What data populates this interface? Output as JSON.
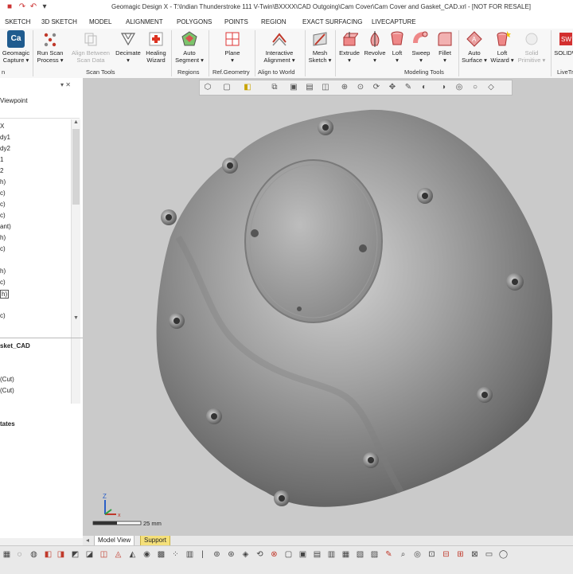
{
  "window": {
    "title": "Geomagic Design X - T:\\Indian Thunderstroke 111 V-Twin\\BXXXX\\CAD Outgoing\\Cam Cover\\Cam Cover and Gasket_CAD.xrl - [NOT FOR RESALE]"
  },
  "menu": [
    "SKETCH",
    "3D SKETCH",
    "MODEL",
    "ALIGNMENT",
    "POLYGONS",
    "POINTS",
    "REGION",
    "EXACT SURFACING",
    "LIVECAPTURE"
  ],
  "ribbon": {
    "buttons": [
      {
        "label1": "Geomagic",
        "label2": "Capture ▾",
        "icon": "capture-icon"
      },
      {
        "label1": "Run Scan",
        "label2": "Process ▾",
        "icon": "scan-process-icon"
      },
      {
        "label1": "Align Between",
        "label2": "Scan Data",
        "icon": "align-scan-icon",
        "disabled": true
      },
      {
        "label1": "Decimate",
        "label2": "▾",
        "icon": "decimate-icon"
      },
      {
        "label1": "Healing",
        "label2": "Wizard",
        "icon": "healing-icon"
      },
      {
        "label1": "Auto",
        "label2": "Segment ▾",
        "icon": "segment-icon"
      },
      {
        "label1": "Plane",
        "label2": "▾",
        "icon": "plane-icon"
      },
      {
        "label1": "Interactive",
        "label2": "Alignment ▾",
        "icon": "alignment-icon"
      },
      {
        "label1": "Mesh",
        "label2": "Sketch ▾",
        "icon": "mesh-sketch-icon"
      },
      {
        "label1": "Extrude",
        "label2": "▾",
        "icon": "extrude-icon"
      },
      {
        "label1": "Revolve",
        "label2": "▾",
        "icon": "revolve-icon"
      },
      {
        "label1": "Loft",
        "label2": "▾",
        "icon": "loft-icon"
      },
      {
        "label1": "Sweep",
        "label2": "▾",
        "icon": "sweep-icon"
      },
      {
        "label1": "Fillet",
        "label2": "▾",
        "icon": "fillet-icon"
      },
      {
        "label1": "Auto",
        "label2": "Surface ▾",
        "icon": "auto-surface-icon"
      },
      {
        "label1": "Loft",
        "label2": "Wizard ▾",
        "icon": "loft-wizard-icon"
      },
      {
        "label1": "Solid",
        "label2": "Primitive ▾",
        "icon": "solid-primitive-icon",
        "disabled": true
      },
      {
        "label1": "SOLIDW",
        "label2": "",
        "icon": "solidworks-icon"
      }
    ],
    "groups": [
      "n",
      "Scan Tools",
      "Regions",
      "Ref.Geometry",
      "Align to World",
      "Modeling Tools",
      "LiveTr"
    ]
  },
  "left_panel": {
    "tabs_header": "▾ ✕",
    "viewpoint": "Viewpoint",
    "tree_items": [
      "X",
      "dy1",
      "dy2",
      "1",
      "2",
      "h)",
      "c)",
      "c)",
      "c)",
      "ant)",
      "h)",
      "c)",
      "",
      "h)",
      "c)",
      "h)",
      "",
      "c)"
    ],
    "section_title": "sket_CAD",
    "lower_items": [
      "(Cut)",
      "(Cut)"
    ],
    "states_label": "tates"
  },
  "viewport": {
    "scale_label": "25 mm",
    "tabs": [
      "Model View",
      "Support"
    ]
  },
  "colors": {
    "accent": "#2b6cb0",
    "viewport_bg": "#cacaca",
    "support_tab": "#f5e07a"
  }
}
